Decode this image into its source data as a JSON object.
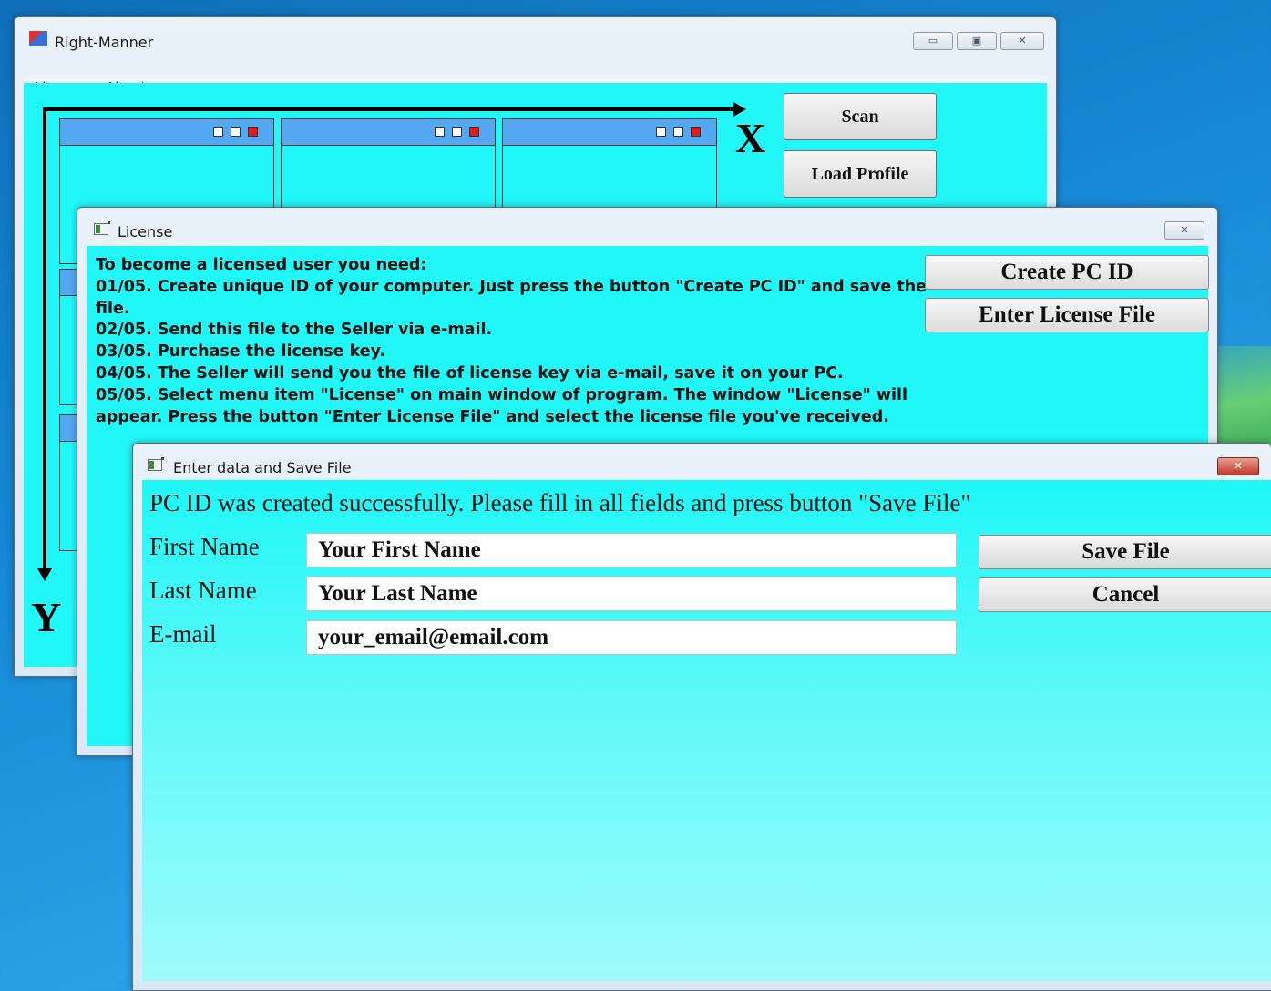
{
  "main_window": {
    "title": "Right-Manner",
    "app_icon": "app-icon",
    "menu": [
      "License",
      "About"
    ],
    "buttons": {
      "scan": "Scan",
      "load_profile": "Load Profile"
    },
    "axis_x": "X",
    "axis_y": "Y"
  },
  "license_window": {
    "title": "License",
    "instructions": [
      "To become a licensed user you need:",
      "01/05. Create unique ID of your computer. Just press the button \"Create PC ID\" and save the",
      "file.",
      "02/05. Send this file to the Seller via e-mail.",
      "03/05. Purchase the license key.",
      "04/05. The Seller will send you the file of license key via e-mail, save it on your PC.",
      "05/05. Select menu item \"License\" on main window of program. The window \"License\" will",
      "appear. Press the button \"Enter License File\" and select the license file you've received."
    ],
    "buttons": {
      "create_pc_id": "Create PC ID",
      "enter_license_file": "Enter License File"
    }
  },
  "enter_window": {
    "title": "Enter data and Save File",
    "message": "PC ID was created successfully. Please fill in all fields and press button \"Save File\"",
    "fields": [
      {
        "label": "First Name",
        "value": "Your First Name"
      },
      {
        "label": "Last Name",
        "value": "Your Last Name"
      },
      {
        "label": "E-mail",
        "value": "your_email@email.com"
      }
    ],
    "buttons": {
      "save_file": "Save File",
      "cancel": "Cancel"
    }
  },
  "caption_glyphs": {
    "minimize": "▭",
    "maximize": "▣",
    "close": "✕"
  }
}
